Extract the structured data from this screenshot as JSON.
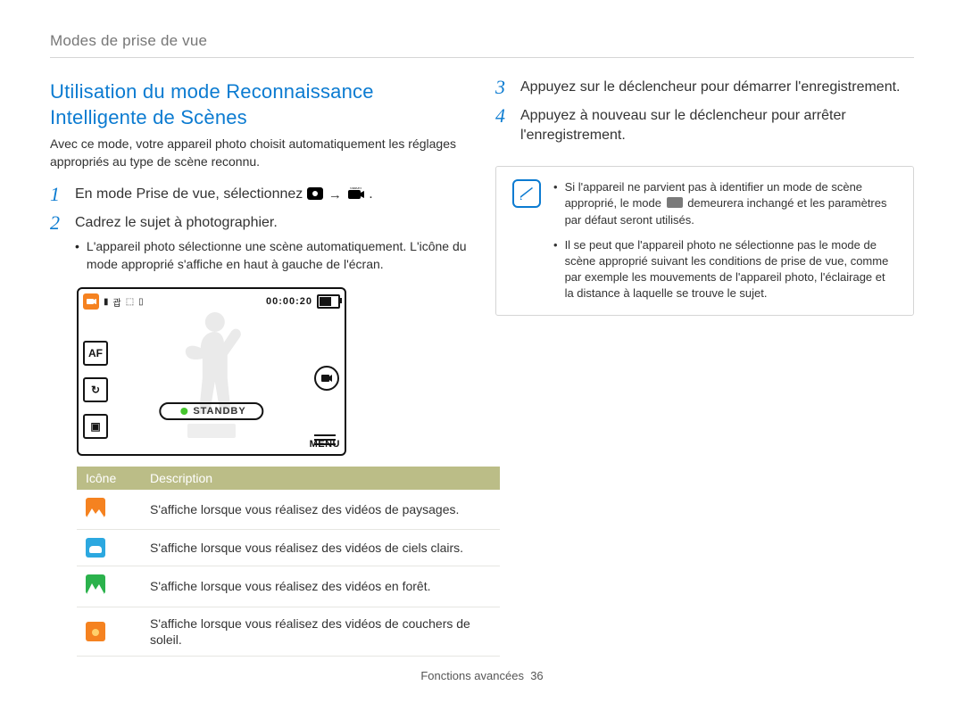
{
  "header": {
    "section": "Modes de prise de vue"
  },
  "left": {
    "title": "Utilisation du mode Reconnaissance Intelligente de Scènes",
    "intro": "Avec ce mode, votre appareil photo choisit automatiquement les réglages appropriés au type de scène reconnu.",
    "step1": {
      "num": "1",
      "pre": "En mode Prise de vue, sélectionnez ",
      "arrow": "→",
      "post": "."
    },
    "step2": {
      "num": "2",
      "text": "Cadrez le sujet à photographier.",
      "sub": "L'appareil photo sélectionne une scène automatiquement. L'icône du mode approprié s'affiche en haut à gauche de l'écran."
    },
    "camera": {
      "time": "00:00:20",
      "standby": "STANDBY",
      "menu": "MENU",
      "af": "AF"
    },
    "table": {
      "h1": "Icône",
      "h2": "Description",
      "rows": [
        {
          "icon": "landscape",
          "desc": "S'affiche lorsque vous réalisez des vidéos de paysages."
        },
        {
          "icon": "sky",
          "desc": "S'affiche lorsque vous réalisez des vidéos de ciels clairs."
        },
        {
          "icon": "forest",
          "desc": "S'affiche lorsque vous réalisez des vidéos en forêt."
        },
        {
          "icon": "sunset",
          "desc": "S'affiche lorsque vous réalisez des vidéos de couchers de soleil."
        }
      ]
    }
  },
  "right": {
    "step3": {
      "num": "3",
      "text": "Appuyez sur le déclencheur pour démarrer l'enregistrement."
    },
    "step4": {
      "num": "4",
      "text": "Appuyez à nouveau sur le déclencheur pour arrêter l'enregistrement."
    },
    "note1a": "Si l'appareil ne parvient pas à identifier un mode de scène approprié, le mode ",
    "note1b": " demeurera inchangé et les paramètres par défaut seront utilisés.",
    "note2": "Il se peut que l'appareil photo ne sélectionne pas le mode de scène approprié suivant les conditions de prise de vue, comme par exemple les mouvements de l'appareil photo, l'éclairage et la distance à laquelle se trouve le sujet."
  },
  "footer": {
    "label": "Fonctions avancées",
    "page": "36"
  }
}
